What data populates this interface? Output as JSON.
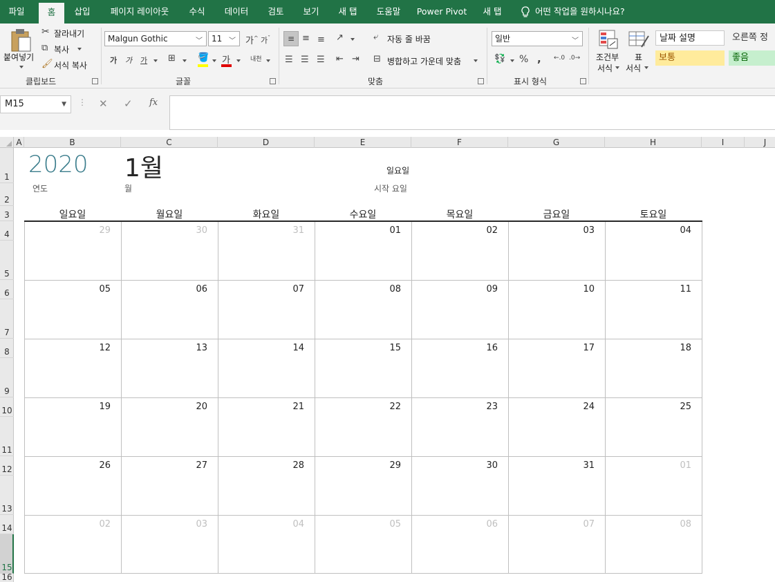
{
  "ribbon_tabs": [
    "파일",
    "홈",
    "삽입",
    "페이지 레이아웃",
    "수식",
    "데이터",
    "검토",
    "보기",
    "새 탭",
    "도움말",
    "Power Pivot",
    "새 탭"
  ],
  "tell_me": "어떤 작업을 원하시나요?",
  "clipboard": {
    "paste": "붙여넣기",
    "cut": "잘라내기",
    "copy": "복사",
    "format_painter": "서식 복사",
    "label": "클립보드"
  },
  "font": {
    "name": "Malgun Gothic",
    "size": "11",
    "label": "글꼴",
    "bold": "가",
    "italic": "가",
    "underline": "가",
    "grow": "가",
    "shrink": "가",
    "font_color_glyph": "가",
    "phonetic": "내천"
  },
  "alignment": {
    "wrap": "자동 줄 바꿈",
    "merge": "병합하고 가운데 맞춤",
    "label": "맞춤"
  },
  "number": {
    "format": "일반",
    "label": "표시 형식",
    "percent": "%",
    "comma": ","
  },
  "styles": {
    "conditional": "조건부\n서식",
    "conditional_l1": "조건부",
    "conditional_l2": "서식",
    "table_l1": "표",
    "table_l2": "서식",
    "date_desc": "날짜 설명",
    "right_align": "오른쪽 정",
    "normal": "보통",
    "good": "좋음"
  },
  "namebox": "M15",
  "formula_value": "",
  "columns": [
    "A",
    "B",
    "C",
    "D",
    "E",
    "F",
    "G",
    "H",
    "I",
    "J"
  ],
  "rows": [
    "1",
    "2",
    "3",
    "4",
    "5",
    "6",
    "7",
    "8",
    "9",
    "10",
    "11",
    "12",
    "13",
    "14",
    "15",
    "16"
  ],
  "selected_row": "15",
  "calendar": {
    "year": "2020",
    "year_label": "연도",
    "month": "1월",
    "month_label": "월",
    "start_day": "일요일",
    "start_day_label": "시작 요일",
    "weekdays": [
      "일요일",
      "월요일",
      "화요일",
      "수요일",
      "목요일",
      "금요일",
      "토요일"
    ],
    "weeks": [
      [
        {
          "d": "29",
          "o": true
        },
        {
          "d": "30",
          "o": true
        },
        {
          "d": "31",
          "o": true
        },
        {
          "d": "01",
          "o": false
        },
        {
          "d": "02",
          "o": false
        },
        {
          "d": "03",
          "o": false
        },
        {
          "d": "04",
          "o": false
        }
      ],
      [
        {
          "d": "05",
          "o": false
        },
        {
          "d": "06",
          "o": false
        },
        {
          "d": "07",
          "o": false
        },
        {
          "d": "08",
          "o": false
        },
        {
          "d": "09",
          "o": false
        },
        {
          "d": "10",
          "o": false
        },
        {
          "d": "11",
          "o": false
        }
      ],
      [
        {
          "d": "12",
          "o": false
        },
        {
          "d": "13",
          "o": false
        },
        {
          "d": "14",
          "o": false
        },
        {
          "d": "15",
          "o": false
        },
        {
          "d": "16",
          "o": false
        },
        {
          "d": "17",
          "o": false
        },
        {
          "d": "18",
          "o": false
        }
      ],
      [
        {
          "d": "19",
          "o": false
        },
        {
          "d": "20",
          "o": false
        },
        {
          "d": "21",
          "o": false
        },
        {
          "d": "22",
          "o": false
        },
        {
          "d": "23",
          "o": false
        },
        {
          "d": "24",
          "o": false
        },
        {
          "d": "25",
          "o": false
        }
      ],
      [
        {
          "d": "26",
          "o": false
        },
        {
          "d": "27",
          "o": false
        },
        {
          "d": "28",
          "o": false
        },
        {
          "d": "29",
          "o": false
        },
        {
          "d": "30",
          "o": false
        },
        {
          "d": "31",
          "o": false
        },
        {
          "d": "01",
          "o": true
        }
      ],
      [
        {
          "d": "02",
          "o": true
        },
        {
          "d": "03",
          "o": true
        },
        {
          "d": "04",
          "o": true
        },
        {
          "d": "05",
          "o": true
        },
        {
          "d": "06",
          "o": true
        },
        {
          "d": "07",
          "o": true
        },
        {
          "d": "08",
          "o": true
        }
      ]
    ]
  },
  "colors": {
    "excel_green": "#217346",
    "year_teal": "#3b7d8c",
    "muted_date": "#bfbfbf",
    "neutral_style": "#ffeb9c",
    "good_style": "#c6efce"
  }
}
